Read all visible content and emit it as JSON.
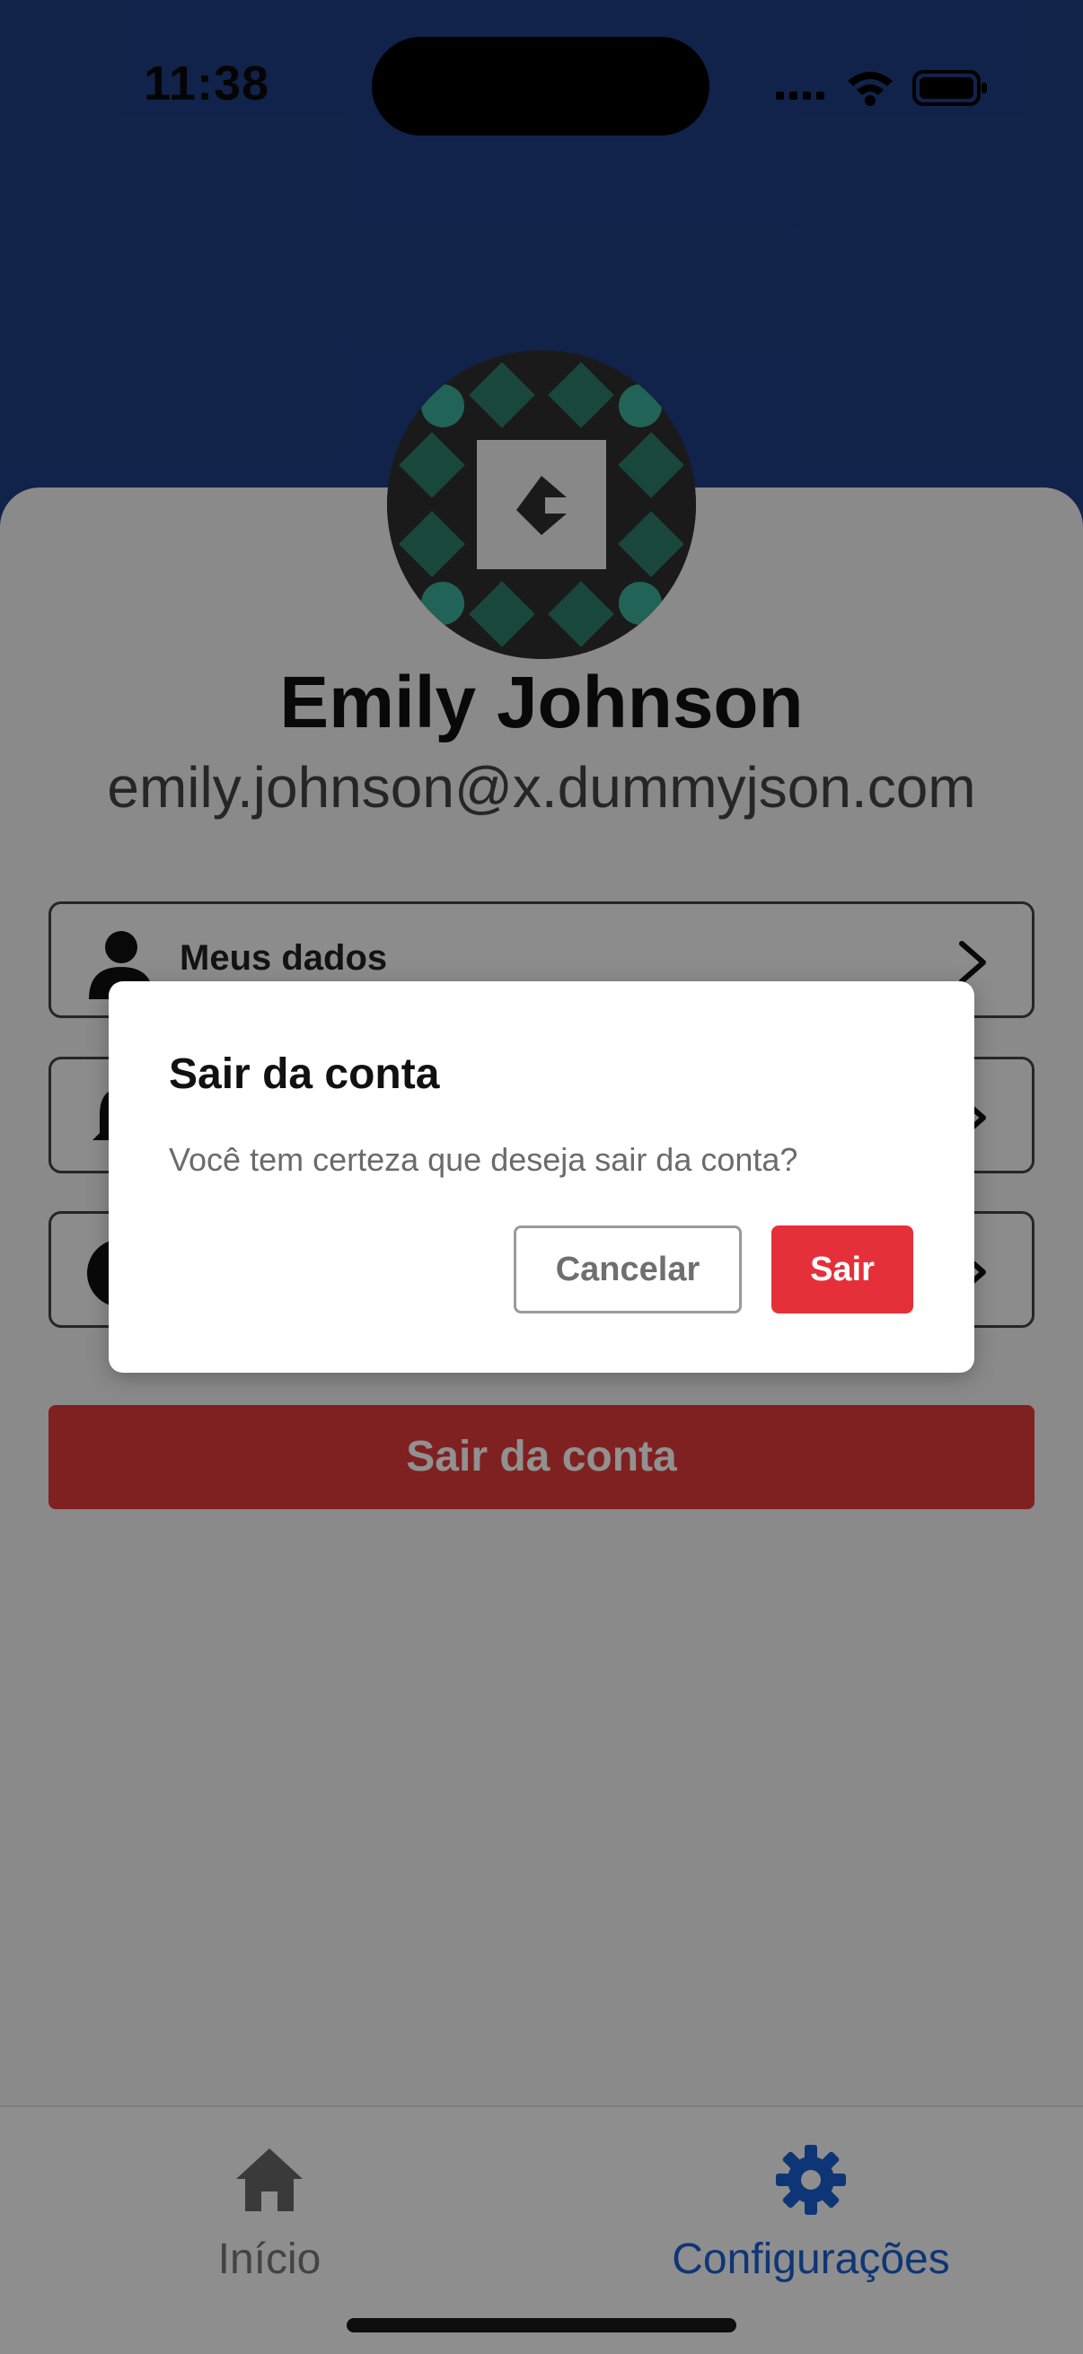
{
  "status_bar": {
    "time": "11:38"
  },
  "profile": {
    "name": "Emily Johnson",
    "email": "emily.johnson@x.dummyjson.com"
  },
  "menu": {
    "items": [
      {
        "label": "Meus dados",
        "icon": "person-icon"
      },
      {
        "label": "",
        "icon": "bell-icon"
      },
      {
        "label": "",
        "icon": "circle-icon"
      }
    ]
  },
  "logout_button": {
    "label": "Sair da conta"
  },
  "dialog": {
    "title": "Sair da conta",
    "message": "Você tem certeza que deseja sair da conta?",
    "cancel_label": "Cancelar",
    "confirm_label": "Sair"
  },
  "tabbar": {
    "tabs": [
      {
        "label": "Início",
        "icon": "home-icon",
        "active": false
      },
      {
        "label": "Configurações",
        "icon": "gear-icon",
        "active": true
      }
    ]
  },
  "colors": {
    "header": "#1e3f82",
    "danger": "#e5303a",
    "active_tab": "#1a5fd0"
  }
}
